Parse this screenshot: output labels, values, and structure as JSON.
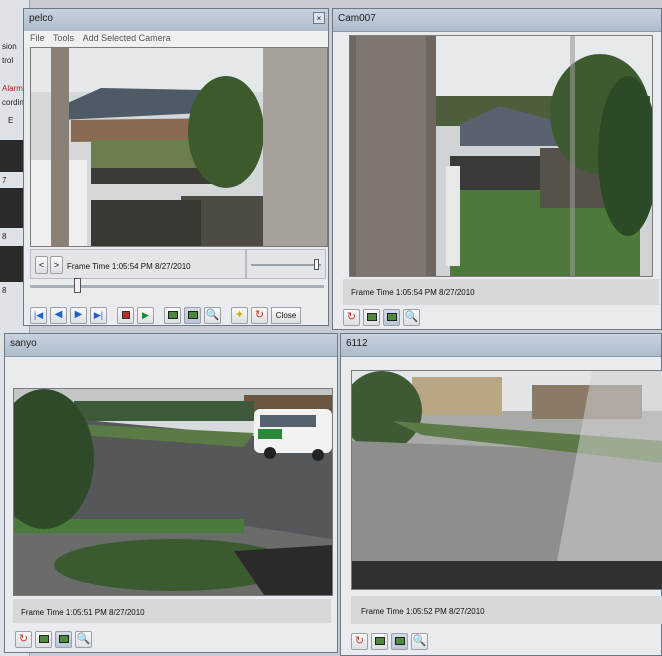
{
  "background_app": {
    "fragments": [
      "sion",
      "trol",
      "Alarm",
      "cordin",
      "E"
    ],
    "row_labels": [
      "7",
      "8",
      "8"
    ]
  },
  "pelco": {
    "title": "pelco",
    "menu": [
      "File",
      "Tools",
      "Add Selected Camera"
    ],
    "frame_time": "Frame Time 1:05:54 PM  8/27/2010",
    "prev_label": "<",
    "next_label": ">",
    "close_label": "Close",
    "timeline_position": 0.15,
    "volume_position": 0.95
  },
  "cam007": {
    "title": "Cam007",
    "frame_time": "Frame Time 1:05:54 PM  8/27/2010"
  },
  "sanyo": {
    "title": "sanyo",
    "frame_time": "Frame Time 1:05:51 PM  8/27/2010"
  },
  "cam6112": {
    "title": "6112",
    "frame_time": "Frame Time 1:05:52 PM  8/27/2010"
  },
  "icons": {
    "first": "skip-first-icon",
    "back": "step-back-icon",
    "forward": "step-forward-icon",
    "last": "skip-last-icon",
    "stop": "stop-icon",
    "play": "play-icon",
    "monitor": "monitor-icon",
    "zoom": "magnifier-icon",
    "bulb": "lightbulb-icon",
    "refresh": "refresh-icon"
  },
  "colors": {
    "accent_blue": "#1f5fd0",
    "refresh_red": "#d23a2a",
    "title_gradient": "#aebccb"
  }
}
